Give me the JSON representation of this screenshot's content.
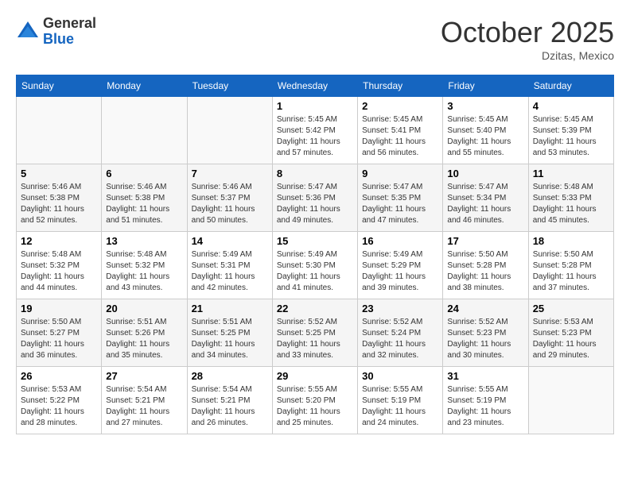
{
  "header": {
    "logo_general": "General",
    "logo_blue": "Blue",
    "month_title": "October 2025",
    "location": "Dzitas, Mexico"
  },
  "days_of_week": [
    "Sunday",
    "Monday",
    "Tuesday",
    "Wednesday",
    "Thursday",
    "Friday",
    "Saturday"
  ],
  "weeks": [
    [
      {
        "day": "",
        "info": ""
      },
      {
        "day": "",
        "info": ""
      },
      {
        "day": "",
        "info": ""
      },
      {
        "day": "1",
        "info": "Sunrise: 5:45 AM\nSunset: 5:42 PM\nDaylight: 11 hours\nand 57 minutes."
      },
      {
        "day": "2",
        "info": "Sunrise: 5:45 AM\nSunset: 5:41 PM\nDaylight: 11 hours\nand 56 minutes."
      },
      {
        "day": "3",
        "info": "Sunrise: 5:45 AM\nSunset: 5:40 PM\nDaylight: 11 hours\nand 55 minutes."
      },
      {
        "day": "4",
        "info": "Sunrise: 5:45 AM\nSunset: 5:39 PM\nDaylight: 11 hours\nand 53 minutes."
      }
    ],
    [
      {
        "day": "5",
        "info": "Sunrise: 5:46 AM\nSunset: 5:38 PM\nDaylight: 11 hours\nand 52 minutes."
      },
      {
        "day": "6",
        "info": "Sunrise: 5:46 AM\nSunset: 5:38 PM\nDaylight: 11 hours\nand 51 minutes."
      },
      {
        "day": "7",
        "info": "Sunrise: 5:46 AM\nSunset: 5:37 PM\nDaylight: 11 hours\nand 50 minutes."
      },
      {
        "day": "8",
        "info": "Sunrise: 5:47 AM\nSunset: 5:36 PM\nDaylight: 11 hours\nand 49 minutes."
      },
      {
        "day": "9",
        "info": "Sunrise: 5:47 AM\nSunset: 5:35 PM\nDaylight: 11 hours\nand 47 minutes."
      },
      {
        "day": "10",
        "info": "Sunrise: 5:47 AM\nSunset: 5:34 PM\nDaylight: 11 hours\nand 46 minutes."
      },
      {
        "day": "11",
        "info": "Sunrise: 5:48 AM\nSunset: 5:33 PM\nDaylight: 11 hours\nand 45 minutes."
      }
    ],
    [
      {
        "day": "12",
        "info": "Sunrise: 5:48 AM\nSunset: 5:32 PM\nDaylight: 11 hours\nand 44 minutes."
      },
      {
        "day": "13",
        "info": "Sunrise: 5:48 AM\nSunset: 5:32 PM\nDaylight: 11 hours\nand 43 minutes."
      },
      {
        "day": "14",
        "info": "Sunrise: 5:49 AM\nSunset: 5:31 PM\nDaylight: 11 hours\nand 42 minutes."
      },
      {
        "day": "15",
        "info": "Sunrise: 5:49 AM\nSunset: 5:30 PM\nDaylight: 11 hours\nand 41 minutes."
      },
      {
        "day": "16",
        "info": "Sunrise: 5:49 AM\nSunset: 5:29 PM\nDaylight: 11 hours\nand 39 minutes."
      },
      {
        "day": "17",
        "info": "Sunrise: 5:50 AM\nSunset: 5:28 PM\nDaylight: 11 hours\nand 38 minutes."
      },
      {
        "day": "18",
        "info": "Sunrise: 5:50 AM\nSunset: 5:28 PM\nDaylight: 11 hours\nand 37 minutes."
      }
    ],
    [
      {
        "day": "19",
        "info": "Sunrise: 5:50 AM\nSunset: 5:27 PM\nDaylight: 11 hours\nand 36 minutes."
      },
      {
        "day": "20",
        "info": "Sunrise: 5:51 AM\nSunset: 5:26 PM\nDaylight: 11 hours\nand 35 minutes."
      },
      {
        "day": "21",
        "info": "Sunrise: 5:51 AM\nSunset: 5:25 PM\nDaylight: 11 hours\nand 34 minutes."
      },
      {
        "day": "22",
        "info": "Sunrise: 5:52 AM\nSunset: 5:25 PM\nDaylight: 11 hours\nand 33 minutes."
      },
      {
        "day": "23",
        "info": "Sunrise: 5:52 AM\nSunset: 5:24 PM\nDaylight: 11 hours\nand 32 minutes."
      },
      {
        "day": "24",
        "info": "Sunrise: 5:52 AM\nSunset: 5:23 PM\nDaylight: 11 hours\nand 30 minutes."
      },
      {
        "day": "25",
        "info": "Sunrise: 5:53 AM\nSunset: 5:23 PM\nDaylight: 11 hours\nand 29 minutes."
      }
    ],
    [
      {
        "day": "26",
        "info": "Sunrise: 5:53 AM\nSunset: 5:22 PM\nDaylight: 11 hours\nand 28 minutes."
      },
      {
        "day": "27",
        "info": "Sunrise: 5:54 AM\nSunset: 5:21 PM\nDaylight: 11 hours\nand 27 minutes."
      },
      {
        "day": "28",
        "info": "Sunrise: 5:54 AM\nSunset: 5:21 PM\nDaylight: 11 hours\nand 26 minutes."
      },
      {
        "day": "29",
        "info": "Sunrise: 5:55 AM\nSunset: 5:20 PM\nDaylight: 11 hours\nand 25 minutes."
      },
      {
        "day": "30",
        "info": "Sunrise: 5:55 AM\nSunset: 5:19 PM\nDaylight: 11 hours\nand 24 minutes."
      },
      {
        "day": "31",
        "info": "Sunrise: 5:55 AM\nSunset: 5:19 PM\nDaylight: 11 hours\nand 23 minutes."
      },
      {
        "day": "",
        "info": ""
      }
    ]
  ]
}
